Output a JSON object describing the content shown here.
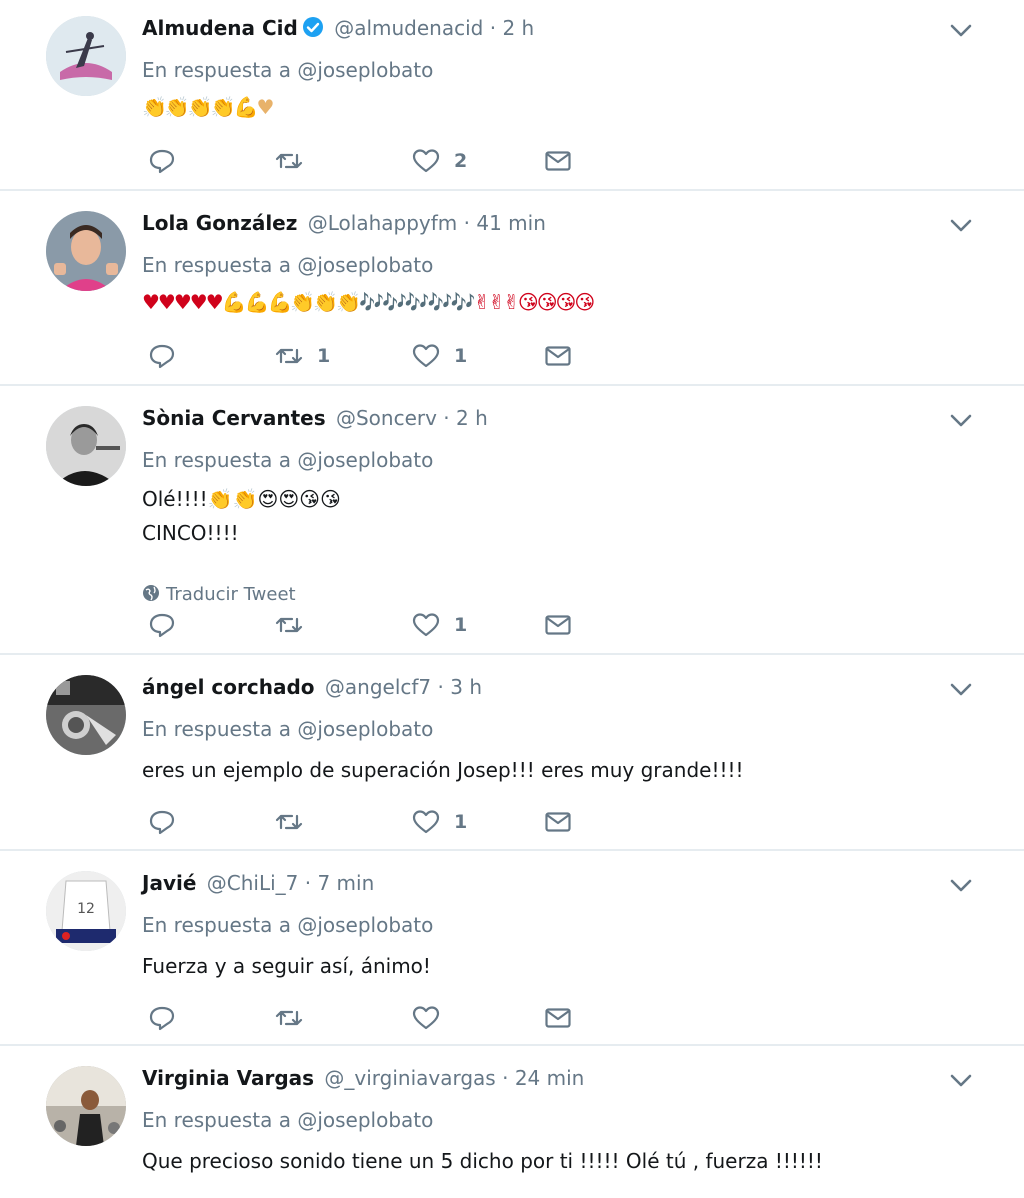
{
  "reply_prefix": "En respuesta a",
  "reply_handle": "@joseplobato",
  "translate_label": "Traducir Tweet",
  "colors": {
    "verified": "#1da1f2",
    "muted": "#657786",
    "divider": "#e6ecf0"
  },
  "tweets": [
    {
      "name": "Almudena Cid",
      "verified": true,
      "handle": "@almudenacid",
      "time": "2 h",
      "text_lines": [
        "👏👏👏👏💪♥"
      ],
      "counts": {
        "reply": "",
        "retweet": "",
        "like": "2"
      }
    },
    {
      "name": "Lola González",
      "handle": "@Lolahappyfm",
      "time": "41 min",
      "text_lines": [
        "♥♥♥♥♥💪💪💪👏👏👏🎶🎶🎶🎶🎶✌✌✌😘😘😘😘"
      ],
      "counts": {
        "reply": "",
        "retweet": "1",
        "like": "1"
      }
    },
    {
      "name": "Sònia Cervantes",
      "handle": "@Soncerv",
      "time": "2 h",
      "text_lines": [
        "Olé!!!!👏👏😍😍😘😘",
        "CINCO!!!!"
      ],
      "translate": true,
      "counts": {
        "reply": "",
        "retweet": "",
        "like": "1"
      }
    },
    {
      "name": "ángel corchado",
      "handle": "@angelcf7",
      "time": "3 h",
      "text_lines": [
        "eres un ejemplo de superación Josep!!! eres muy grande!!!!"
      ],
      "counts": {
        "reply": "",
        "retweet": "",
        "like": "1"
      }
    },
    {
      "name": "Javié",
      "handle": "@ChiLi_7",
      "time": "7 min",
      "text_lines": [
        "Fuerza y a seguir así, ánimo!"
      ],
      "counts": {
        "reply": "",
        "retweet": "",
        "like": ""
      }
    },
    {
      "name": "Virginia Vargas",
      "handle": "@_virginiavargas",
      "time": "24 min",
      "text_lines": [
        "Que precioso sonido tiene un 5 dicho por ti !!!!! Olé tú , fuerza !!!!!!"
      ],
      "counts": {
        "reply": "",
        "retweet": "",
        "like": ""
      }
    }
  ]
}
